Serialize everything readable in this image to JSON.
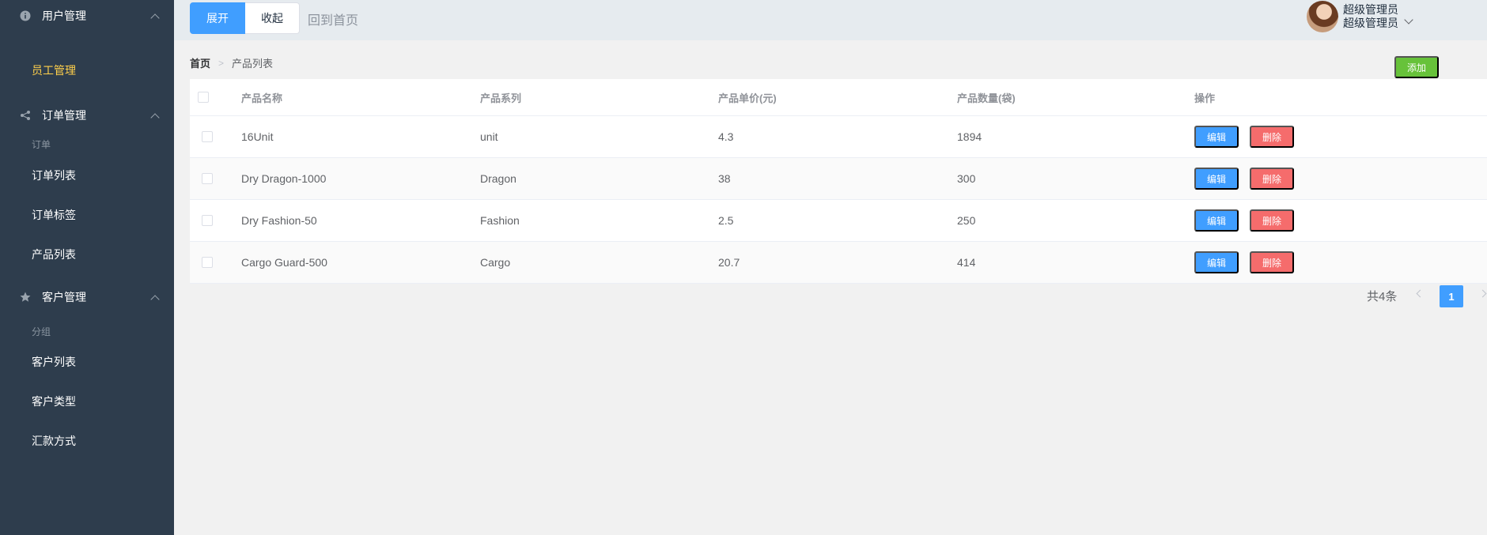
{
  "sidebar": {
    "groups": [
      {
        "label": "用户管理",
        "icon": "info-icon"
      },
      {
        "label": "订单管理",
        "icon": "share-icon"
      },
      {
        "label": "客户管理",
        "icon": "star-icon"
      }
    ],
    "user_items": [
      {
        "label": "员工管理"
      }
    ],
    "order_sub_title": "订单",
    "order_items": [
      {
        "label": "订单列表"
      },
      {
        "label": "订单标签"
      },
      {
        "label": "产品列表"
      }
    ],
    "customer_sub_title": "分组",
    "customer_items": [
      {
        "label": "客户列表"
      },
      {
        "label": "客户类型"
      },
      {
        "label": "汇款方式"
      }
    ]
  },
  "header": {
    "expand_label": "展开",
    "collapse_label": "收起",
    "home_link": "回到首页",
    "user_name": "超级管理员",
    "user_role": "超级管理员"
  },
  "breadcrumb": {
    "home": "首页",
    "current": "产品列表"
  },
  "actions": {
    "add_label": "添加"
  },
  "table": {
    "columns": [
      "产品名称",
      "产品系列",
      "产品单价(元)",
      "产品数量(袋)",
      "操作"
    ],
    "edit_label": "编辑",
    "delete_label": "删除",
    "rows": [
      {
        "name": "16Unit",
        "series": "unit",
        "price": "4.3",
        "quantity": "1894"
      },
      {
        "name": "Dry Dragon-1000",
        "series": "Dragon",
        "price": "38",
        "quantity": "300"
      },
      {
        "name": "Dry Fashion-50",
        "series": "Fashion",
        "price": "2.5",
        "quantity": "250"
      },
      {
        "name": "Cargo Guard-500",
        "series": "Cargo",
        "price": "20.7",
        "quantity": "414"
      }
    ]
  },
  "pagination": {
    "total": "共4条",
    "current_page": "1"
  },
  "colors": {
    "sidebar_bg": "#2e3d4d",
    "active_text": "#ffd04b",
    "primary": "#409eff",
    "danger": "#f56c6c",
    "success": "#67c23a"
  }
}
